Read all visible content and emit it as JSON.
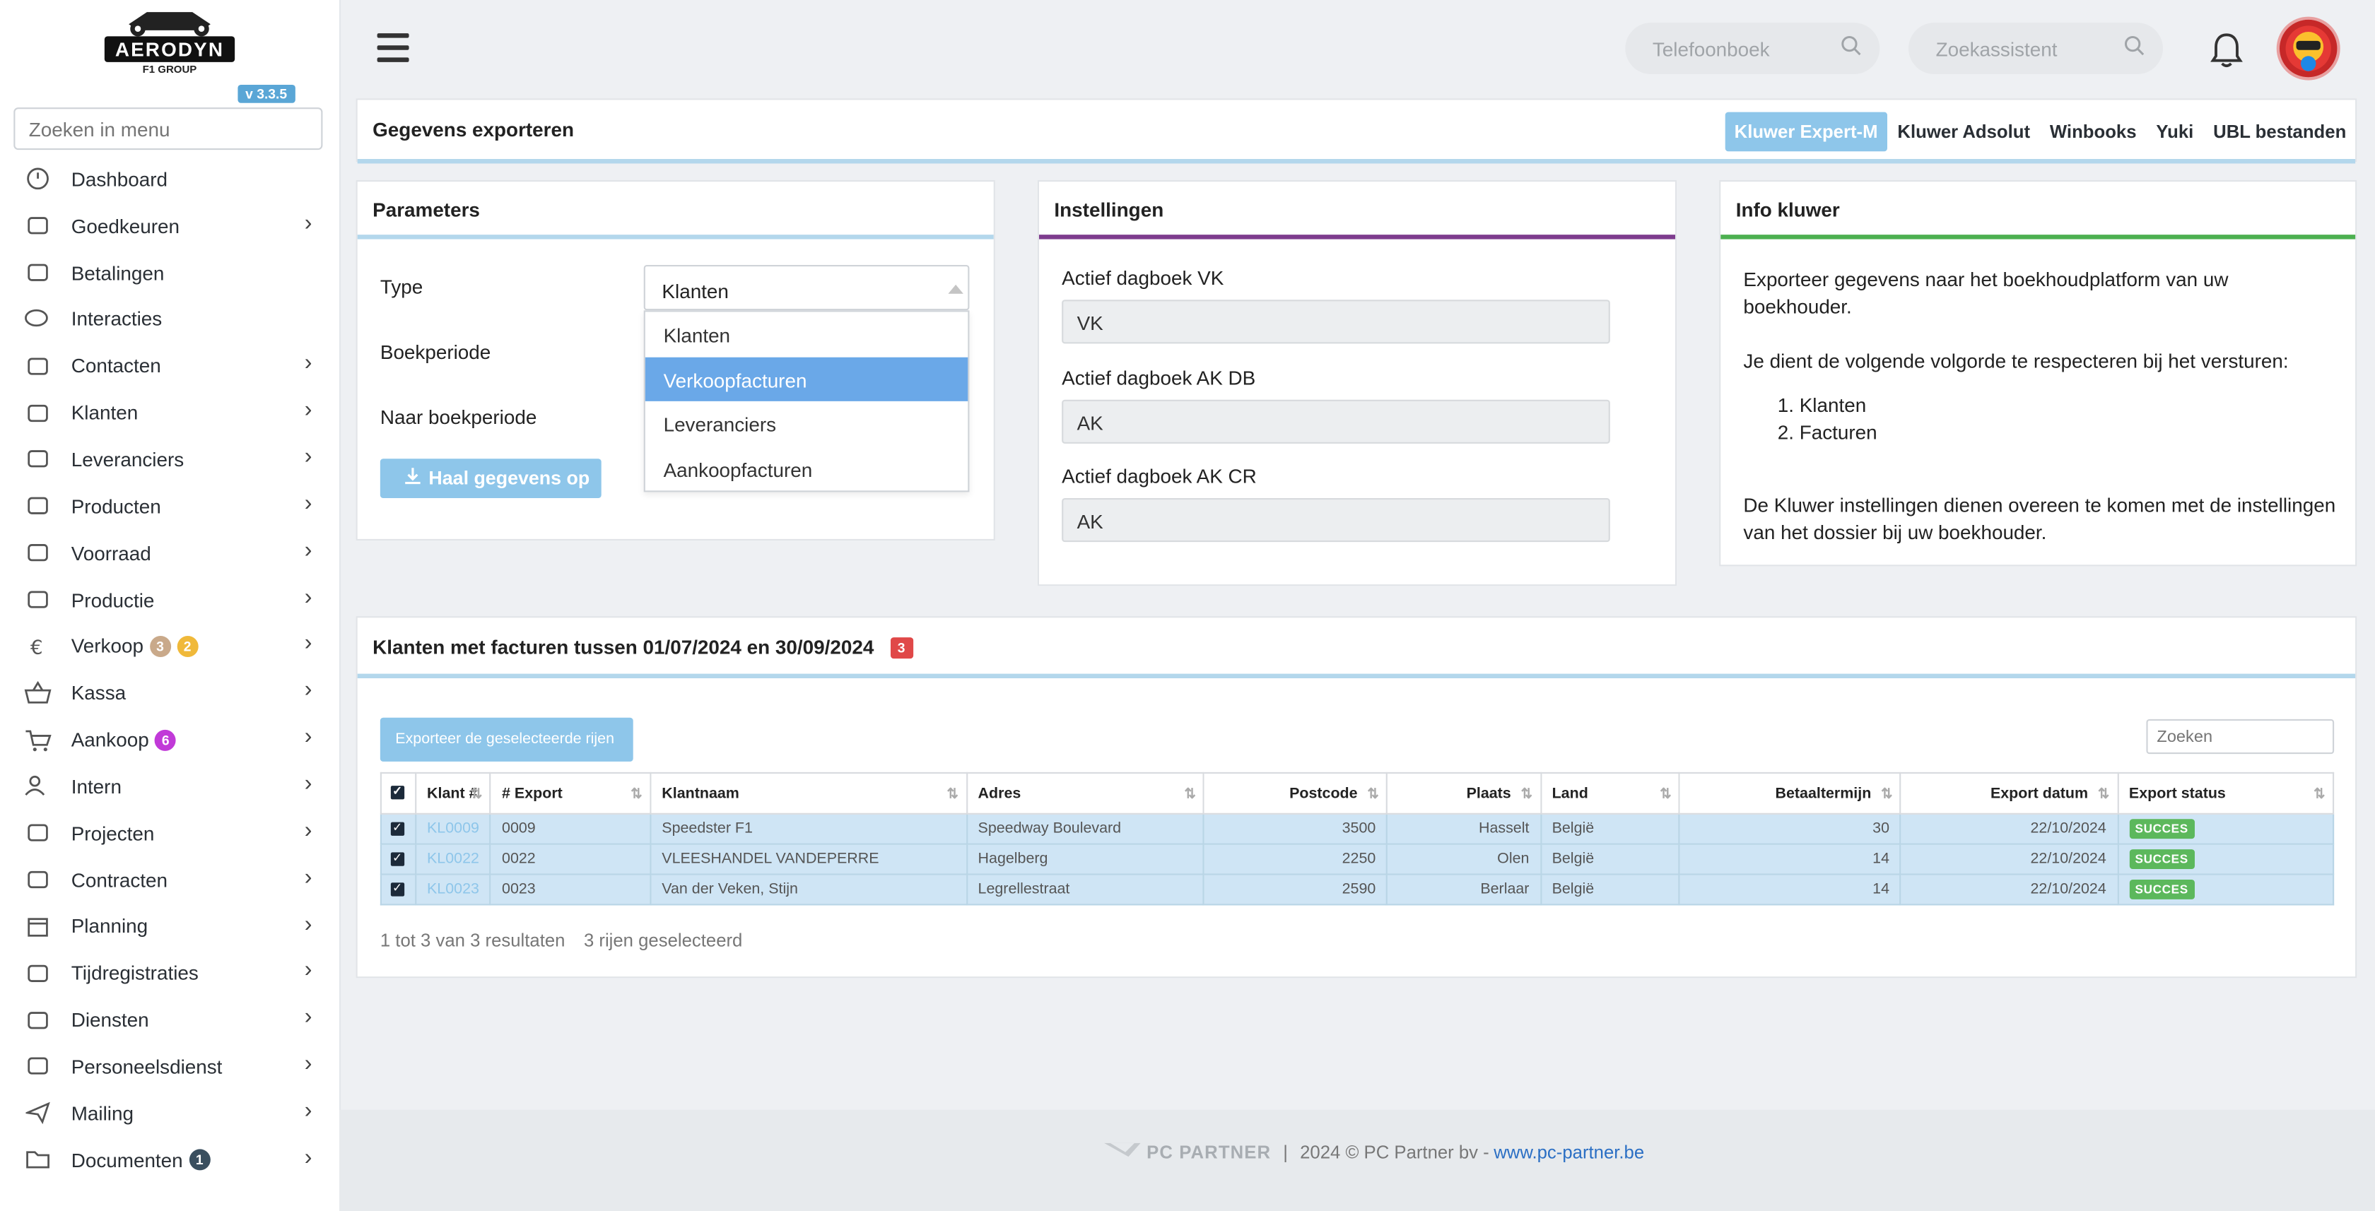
{
  "sidebar": {
    "logo_text": "AERODYN",
    "logo_subtext": "F1 GROUP",
    "version": "v 3.3.5",
    "search_placeholder": "Zoeken in menu",
    "items": [
      {
        "label": "Dashboard",
        "icon": "dashboard-icon",
        "chevron": false
      },
      {
        "label": "Goedkeuren",
        "icon": "user-check-icon",
        "chevron": true
      },
      {
        "label": "Betalingen",
        "icon": "card-icon",
        "chevron": false
      },
      {
        "label": "Interacties",
        "icon": "chat-icon",
        "chevron": false
      },
      {
        "label": "Contacten",
        "icon": "contact-card-icon",
        "chevron": true
      },
      {
        "label": "Klanten",
        "icon": "customer-icon",
        "chevron": true
      },
      {
        "label": "Leveranciers",
        "icon": "truck-icon",
        "chevron": true
      },
      {
        "label": "Producten",
        "icon": "box-icon",
        "chevron": true
      },
      {
        "label": "Voorraad",
        "icon": "boxes-icon",
        "chevron": true
      },
      {
        "label": "Productie",
        "icon": "gears-icon",
        "chevron": true
      },
      {
        "label": "Verkoop",
        "icon": "euro-icon",
        "chevron": true,
        "badges": [
          "3",
          "2"
        ]
      },
      {
        "label": "Kassa",
        "icon": "basket-icon",
        "chevron": true
      },
      {
        "label": "Aankoop",
        "icon": "cart-icon",
        "chevron": true,
        "badges": [
          "6"
        ]
      },
      {
        "label": "Intern",
        "icon": "users-icon",
        "chevron": true
      },
      {
        "label": "Projecten",
        "icon": "project-icon",
        "chevron": true
      },
      {
        "label": "Contracten",
        "icon": "document-icon",
        "chevron": true
      },
      {
        "label": "Planning",
        "icon": "calendar-icon",
        "chevron": true
      },
      {
        "label": "Tijdregistraties",
        "icon": "clock-icon",
        "chevron": true
      },
      {
        "label": "Diensten",
        "icon": "repeat-icon",
        "chevron": true
      },
      {
        "label": "Personeelsdienst",
        "icon": "staff-icon",
        "chevron": true
      },
      {
        "label": "Mailing",
        "icon": "send-icon",
        "chevron": true
      },
      {
        "label": "Documenten",
        "icon": "folder-icon",
        "chevron": true,
        "badges": [
          "1"
        ]
      }
    ],
    "badge_colors": {
      "3": "#c9a98a",
      "2": "#f0b93a",
      "6": "#c13ad8",
      "1": "#3a4f5f"
    }
  },
  "topbar": {
    "phonebook_placeholder": "Telefoonboek",
    "assistant_placeholder": "Zoekassistent"
  },
  "export_header": {
    "title": "Gegevens exporteren",
    "tabs": [
      "Kluwer Expert-M",
      "Kluwer Adsolut",
      "Winbooks",
      "Yuki",
      "UBL bestanden"
    ],
    "active_tab": "Kluwer Expert-M"
  },
  "parameters": {
    "title": "Parameters",
    "type_label": "Type",
    "type_value": "Klanten",
    "period_label": "Boekperiode",
    "to_period_label": "Naar boekperiode",
    "fetch_button": "Haal gegevens op",
    "options": [
      "Klanten",
      "Verkoopfacturen",
      "Leveranciers",
      "Aankoopfacturen"
    ],
    "highlighted_option": "Verkoopfacturen"
  },
  "settings": {
    "title": "Instellingen",
    "fields": [
      {
        "label": "Actief dagboek VK",
        "value": "VK"
      },
      {
        "label": "Actief dagboek AK DB",
        "value": "AK"
      },
      {
        "label": "Actief dagboek AK CR",
        "value": "AK"
      }
    ]
  },
  "info": {
    "title": "Info kluwer",
    "intro": "Exporteer gegevens naar het boekhoudplatform van uw boekhouder.",
    "order_text": "Je dient de volgende volgorde te respecteren bij het versturen:",
    "steps": [
      "Klanten",
      "Facturen"
    ],
    "note": "De Kluwer instellingen dienen overeen te komen met de instellingen van het dossier bij uw boekhouder."
  },
  "results": {
    "title": "Klanten met facturen tussen 01/07/2024 en 30/09/2024",
    "count_badge": "3",
    "export_button": "Exporteer de geselecteerde rijen",
    "search_placeholder": "Zoeken",
    "columns": [
      "Klant #",
      "# Export",
      "Klantnaam",
      "Adres",
      "Postcode",
      "Plaats",
      "Land",
      "Betaaltermijn",
      "Export datum",
      "Export status"
    ],
    "rows": [
      {
        "klant": "KL0009",
        "export": "0009",
        "naam": "Speedster F1",
        "adres": "Speedway Boulevard",
        "postcode": "3500",
        "plaats": "Hasselt",
        "land": "België",
        "termijn": "30",
        "datum": "22/10/2024",
        "status": "SUCCES"
      },
      {
        "klant": "KL0022",
        "export": "0022",
        "naam": "VLEESHANDEL VANDEPERRE",
        "adres": "Hagelberg",
        "postcode": "2250",
        "plaats": "Olen",
        "land": "België",
        "termijn": "14",
        "datum": "22/10/2024",
        "status": "SUCCES"
      },
      {
        "klant": "KL0023",
        "export": "0023",
        "naam": "Van der Veken, Stijn",
        "adres": "Legrellestraat",
        "postcode": "2590",
        "plaats": "Berlaar",
        "land": "België",
        "termijn": "14",
        "datum": "22/10/2024",
        "status": "SUCCES"
      }
    ],
    "summary": "1 tot 3 van 3 resultaten",
    "selected": "3 rijen geselecteerd"
  },
  "footer": {
    "brand": "PC PARTNER",
    "text": "2024 © PC Partner bv -",
    "link": "www.pc-partner.be"
  }
}
